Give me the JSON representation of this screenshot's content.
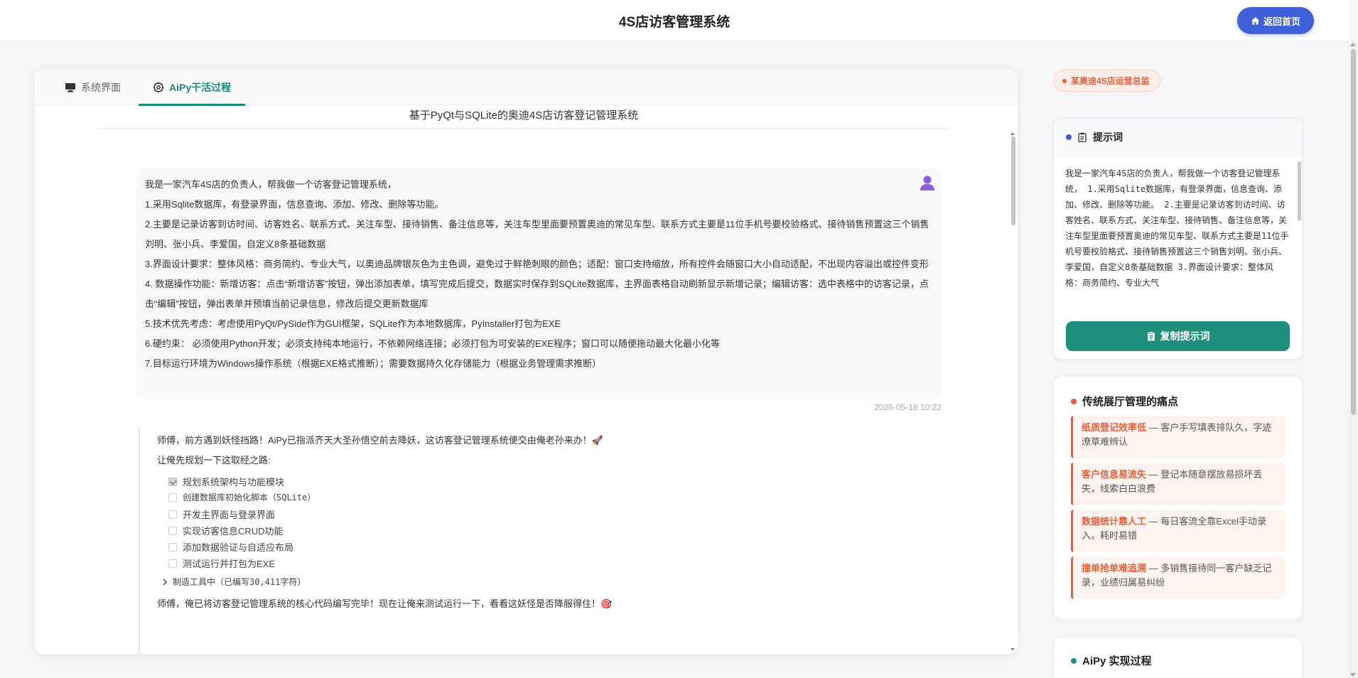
{
  "header": {
    "title": "4S店访客管理系统",
    "home_button": "返回首页"
  },
  "tabs": [
    {
      "label": "系统界面",
      "icon": "monitor-icon",
      "active": false
    },
    {
      "label": "AiPy干活过程",
      "icon": "gear-icon",
      "active": true
    }
  ],
  "main": {
    "doc_title": "基于PyQt与SQLite的奥迪4S店访客登记管理系统",
    "user_message": [
      "我是一家汽车4S店的负责人，帮我做一个访客登记管理系统，",
      "1.采用Sqlite数据库，有登录界面，信息查询、添加、修改、删除等功能。",
      "2.主要是记录访客到访时间、访客姓名、联系方式、关注车型、接待销售、备注信息等，关注车型里面要预置奥迪的常见车型、联系方式主要是11位手机号要校验格式、接待销售预置这三个销售刘明、张小兵、李爱国，自定义8条基础数据",
      "3.界面设计要求：整体风格：商务简约、专业大气，以奥迪品牌银灰色为主色调，避免过于鲜艳刺眼的颜色；适配：窗口支持缩放，所有控件会随窗口大小自动适配，不出现内容溢出或控件变形",
      "4. 数据操作功能：新增访客：点击“新增访客”按钮，弹出添加表单，填写完成后提交，数据实时保存到SQLite数据库，主界面表格自动刷新显示新增记录；编辑访客：选中表格中的访客记录，点击“编辑”按钮，弹出表单并预填当前记录信息，修改后提交更新数据库",
      "5.技术优先考虑：考虑使用PyQt/PySide作为GUI框架，SQLite作为本地数据库，PyInstaller打包为EXE",
      "6.硬约束：  必须使用Python开发；必须支持纯本地运行，不依赖网络连接；必须打包为可安装的EXE程序；窗口可以随便拖动最大化最小化等",
      "7.目标运行环境为Windows操作系统（根据EXE格式推断）；需要数据持久化存储能力（根据业务管理需求推断）"
    ],
    "timestamp": "2026-05-18 10:22",
    "ai_intro": "师傅，前方遇到妖怪挡路！AiPy已指派齐天大圣孙悟空前去降妖，这访客登记管理系统便交由俺老孙来办！🚀",
    "ai_plan_heading": "让俺先规划一下这取经之路:",
    "plan_items": [
      {
        "label": "规划系统架构与功能模块",
        "checked": true
      },
      {
        "label": "创建数据库初始化脚本（SQLite）",
        "checked": false
      },
      {
        "label": "开发主界面与登录界面",
        "checked": false
      },
      {
        "label": "实现访客信息CRUD功能",
        "checked": false
      },
      {
        "label": "添加数据验证与自适应布局",
        "checked": false
      },
      {
        "label": "测试运行并打包为EXE",
        "checked": false
      }
    ],
    "tool_status": "制造工具中（已编写30,411字符）",
    "ai_followup": "师傅，俺已将访客登记管理系统的核心代码编写完毕！现在让俺来测试运行一下，看看这妖怪是否降服得住！🎯"
  },
  "sidebar": {
    "badge": "某奥迪4S店运营总监",
    "prompt_card": {
      "title": "提示词",
      "text": "我是一家汽车4S店的负责人，帮我做一个访客登记管理系统，\n1.采用Sqlite数据库，有登录界面，信息查询、添加、修改、删除等功能。\n2.主要是记录访客到访时间、访客姓名、联系方式、关注车型、接待销售、备注信息等，关注车型里面要预置奥迪的常见车型、联系方式主要是11位手机号要校验格式、接待销售预置这三个销售刘明、张小兵、李爱国，自定义8条基础数据\n3.界面设计要求：整体风格：商务简约、专业大气",
      "copy_button": "复制提示词"
    },
    "pain_card": {
      "title": "传统展厅管理的痛点",
      "items": [
        {
          "highlight": "纸质登记效率低",
          "text": " — 客户手写填表排队久，字迹潦草难辨认"
        },
        {
          "highlight": "客户信息易流失",
          "text": " — 登记本随意摆放易损坏丢失，线索白白浪费"
        },
        {
          "highlight": "数据统计靠人工",
          "text": " — 每日客流全靠Excel手动录入，耗时易错"
        },
        {
          "highlight": "撞单抢单难追溯",
          "text": " — 多销售接待同一客户缺乏记录，业绩归属易纠纷"
        }
      ]
    },
    "impl_card": {
      "title": "AiPy 实现过程"
    }
  },
  "colors": {
    "accent_blue": "#3f5fd8",
    "accent_teal": "#1f8f7c",
    "accent_orange": "#e4603d"
  }
}
